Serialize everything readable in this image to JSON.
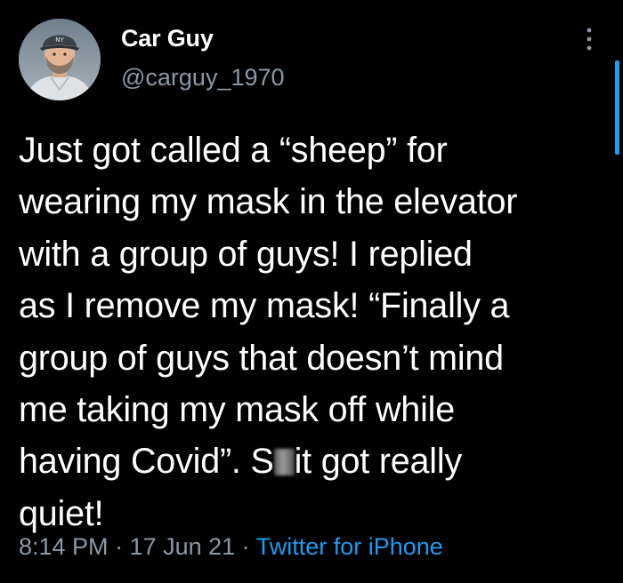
{
  "tweet": {
    "author": {
      "display_name": "Car Guy",
      "handle": "@carguy_1970",
      "avatar_icon": "avatar-photo"
    },
    "more_icon": "more-vertical-icon",
    "text": {
      "part1": "Just got called a “sheep” for\nwearing my mask in the elevator\nwith a group of guys! I replied\nas I remove my mask! “Finally a\ngroup of guys that doesn’t mind\nme taking my mask off while\nhaving Covid”.  S",
      "part2": "it got really\nquiet!"
    },
    "meta": {
      "time": "8:14 PM",
      "separator1": " · ",
      "date": "17 Jun 21",
      "separator2": " · ",
      "source": "Twitter for iPhone"
    },
    "colors": {
      "background": "#000000",
      "text": "#ffffff",
      "secondary": "#8b98a5",
      "accent": "#1d9bf0"
    }
  }
}
